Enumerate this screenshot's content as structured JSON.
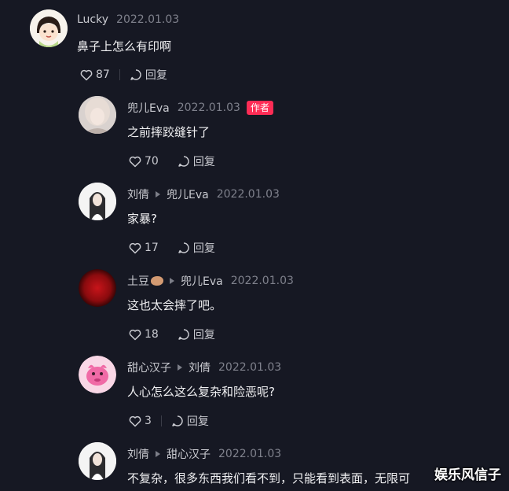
{
  "comments": [
    {
      "author": "Lucky",
      "reply_to": "",
      "date": "2022.01.03",
      "badge": "",
      "text": "鼻子上怎么有印啊",
      "likes": "87",
      "reply_label": "回复"
    },
    {
      "author": "兜儿Eva",
      "reply_to": "",
      "date": "2022.01.03",
      "badge": "作者",
      "text": "之前摔跤缝针了",
      "likes": "70",
      "reply_label": "回复"
    },
    {
      "author": "刘倩",
      "reply_to": "兜儿Eva",
      "date": "2022.01.03",
      "badge": "",
      "text": "家暴?",
      "likes": "17",
      "reply_label": "回复"
    },
    {
      "author": "土豆",
      "reply_to": "兜儿Eva",
      "date": "2022.01.03",
      "badge": "",
      "text": "这也太会摔了吧。",
      "likes": "18",
      "reply_label": "回复"
    },
    {
      "author": "甜心汉子",
      "reply_to": "刘倩",
      "date": "2022.01.03",
      "badge": "",
      "text": "人心怎么这么复杂和险恶呢?",
      "likes": "3",
      "reply_label": "回复"
    },
    {
      "author": "刘倩",
      "reply_to": "甜心汉子",
      "date": "2022.01.03",
      "badge": "",
      "text": "不复杂，很多东西我们看不到，只能看到表面，无限可",
      "likes": "",
      "reply_label": ""
    }
  ],
  "watermark": "娱乐风信子",
  "colors": {
    "accent": "#fe2c55",
    "background": "#161823"
  }
}
